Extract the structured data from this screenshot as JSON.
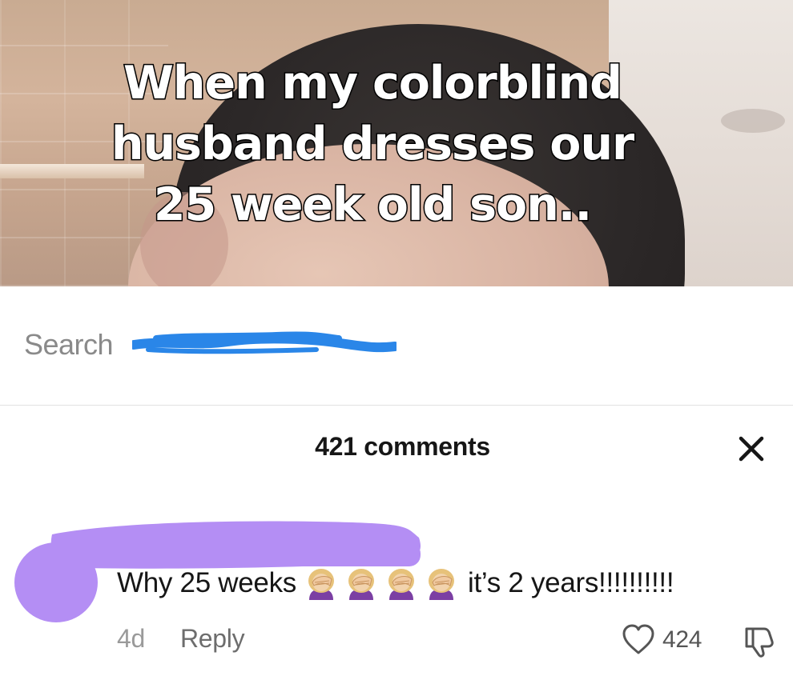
{
  "video": {
    "caption_line1": "When my colorblind",
    "caption_line2": "husband dresses our",
    "caption_line3": "25 week old son.."
  },
  "search": {
    "label": "Search"
  },
  "comments_panel": {
    "count_label": "421 comments",
    "close_icon": "close-x-icon"
  },
  "comment": {
    "text_before": "Why 25 weeks",
    "emoji_icon": "woman-facepalming-icon",
    "emoji_count": 4,
    "text_after": "it’s 2 years!!!!!!!!!!",
    "timestamp": "4d",
    "reply_label": "Reply",
    "like_count": "424",
    "like_icon": "heart-outline-icon",
    "dislike_icon": "thumbs-down-icon"
  },
  "colors": {
    "avatar_redaction": "#b48ef4",
    "search_redaction": "#2a86e8",
    "text_primary": "#161616",
    "text_secondary": "#8a8a8a"
  }
}
